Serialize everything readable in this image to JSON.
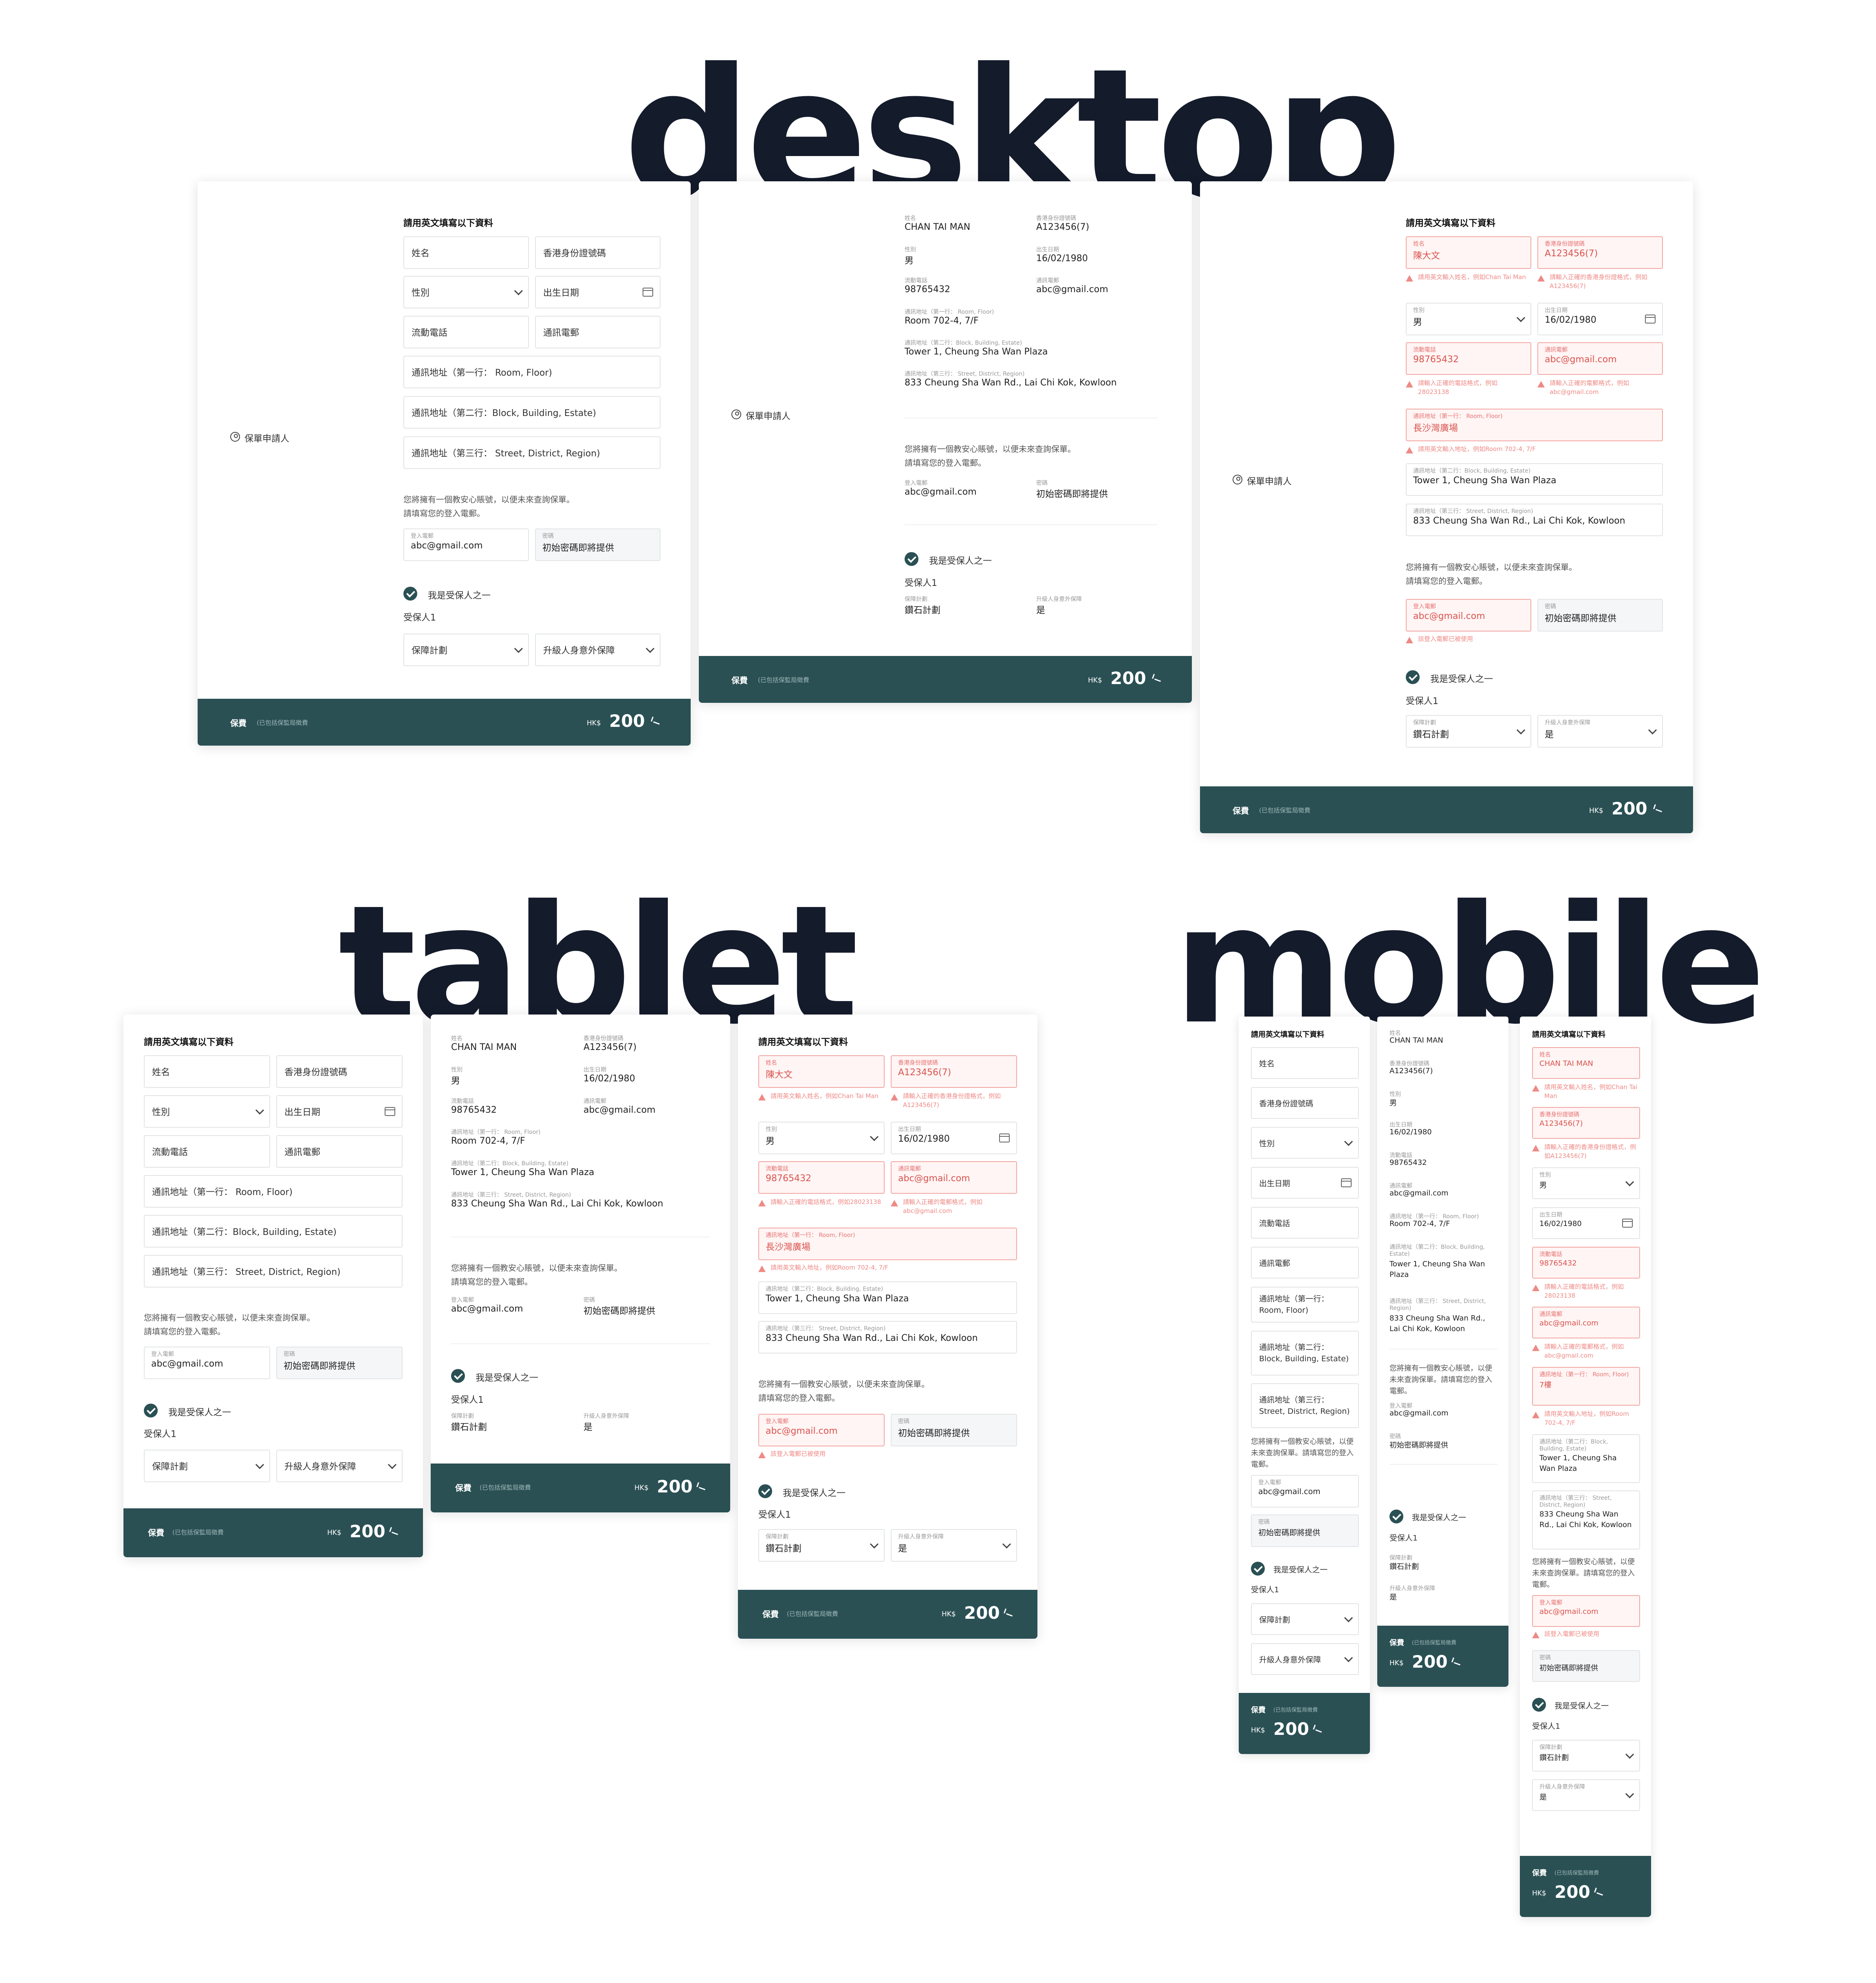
{
  "titles": {
    "desktop": "desktop",
    "tablet": "tablet",
    "mobile": "mobile"
  },
  "text": {
    "fill_in_english": "請用英文填寫以下資料",
    "applicant": "保單申請人",
    "name": "姓名",
    "hkid": "香港身份證號碼",
    "gender": "性別",
    "dob": "出生日期",
    "mobile": "流動電話",
    "email": "通訊電郵",
    "addr1": "通訊地址（第一行： Room, Floor)",
    "addr2": "通訊地址（第二行：Block, Building, Estate)",
    "addr3": "通訊地址（第三行： Street, District, Region)",
    "addr1_short": "通訊地址（第一行： Room, Floor)",
    "addr2_short": "通訊地址（第二行：Block, Building, Estate)",
    "addr3_short": "通訊地址（第三行： Street, District, Region)",
    "account_note1": "您將擁有一個教安心賬號，以便未來查詢保單。",
    "account_note2": "請填寫您的登入電郵。",
    "login_email": "登入電郵",
    "password": "密碼",
    "insured_toggle": "我是受保人之一",
    "insured1": "受保人1",
    "plan": "保障計劃",
    "upgrade": "升級人身意外保障",
    "fee": "保費",
    "fee_sub": "(已包括保監局徵費",
    "currency": "HK$",
    "amount": "200"
  },
  "values": {
    "name_en": "CHAN TAI MAN",
    "name_zh": "陳大文",
    "hkid": "A123456(7)",
    "gender": "男",
    "dob": "16/02/1980",
    "mobile": "98765432",
    "email": "abc@gmail.com",
    "addr1": "Room 702-4, 7/F",
    "addr1_err": "長沙灣廣場",
    "addr1_err_short": "7樓",
    "addr2": "Tower 1, Cheung Sha Wan Plaza",
    "addr3": "833 Cheung Sha Wan Rd., Lai Chi Kok, Kowloon",
    "login_email": "abc@gmail.com",
    "password": "初始密碼即將提供",
    "plan": "鑽石計劃",
    "upgrade": "是"
  },
  "errors": {
    "name": "請用英文輸入姓名，例如Chan Tai Man",
    "hkid": "請輸入正確的香港身份證格式，例如A123456(7)",
    "mobile": "請輸入正確的電話格式，例如28023138",
    "email": "請輸入正確的電郵格式，例如abc@gmail.com",
    "addr": "請用英文輸入地址，例如Room 702-4, 7/F",
    "login": "該登入電郵已被使用"
  },
  "colors": {
    "accent": "#2a5054",
    "error": "#ee8a86",
    "title": "#141b2b"
  }
}
